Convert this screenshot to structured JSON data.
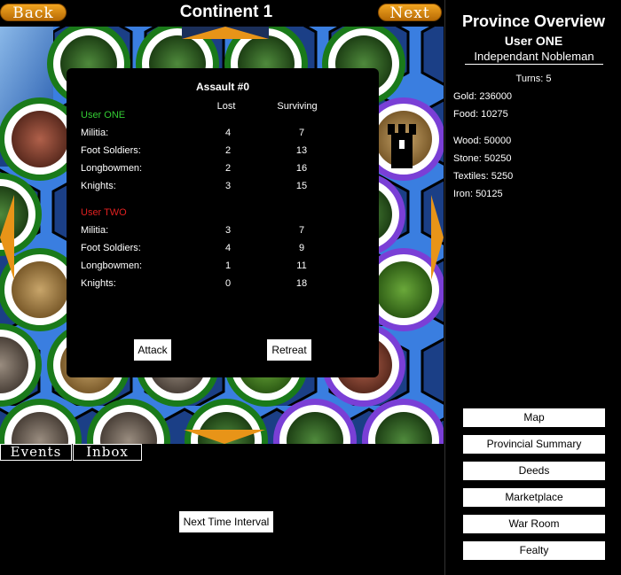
{
  "header": {
    "back_label": "Back",
    "next_label": "Next",
    "title": "Continent 1"
  },
  "dialog": {
    "title": "Assault #0",
    "col_lost": "Lost",
    "col_surviving": "Surviving",
    "sides": [
      {
        "name": "User ONE",
        "color": "#33cc33",
        "rows": [
          {
            "unit": "Militia:",
            "lost": "4",
            "surviving": "7"
          },
          {
            "unit": "Foot Soldiers:",
            "lost": "2",
            "surviving": "13"
          },
          {
            "unit": "Longbowmen:",
            "lost": "2",
            "surviving": "16"
          },
          {
            "unit": "Knights:",
            "lost": "3",
            "surviving": "15"
          }
        ]
      },
      {
        "name": "User TWO",
        "color": "#e02020",
        "rows": [
          {
            "unit": "Militia:",
            "lost": "3",
            "surviving": "7"
          },
          {
            "unit": "Foot Soldiers:",
            "lost": "4",
            "surviving": "9"
          },
          {
            "unit": "Longbowmen:",
            "lost": "1",
            "surviving": "11"
          },
          {
            "unit": "Knights:",
            "lost": "0",
            "surviving": "18"
          }
        ]
      }
    ],
    "attack_label": "Attack",
    "retreat_label": "Retreat"
  },
  "bottom": {
    "tab_events": "Events",
    "tab_inbox": "Inbox",
    "next_interval_label": "Next Time Interval"
  },
  "province": {
    "title": "Province Overview",
    "user": "User ONE",
    "rank": "Independant Nobleman",
    "turns": "Turns: 5",
    "gold": "Gold: 236000",
    "food": "Food: 10275",
    "wood": "Wood: 50000",
    "stone": "Stone: 50250",
    "textiles": "Textiles: 5250",
    "iron": "Iron: 50125"
  },
  "menu": [
    "Map",
    "Provincial Summary",
    "Deeds",
    "Marketplace",
    "War Room",
    "Fealty"
  ],
  "colors": {
    "accent_orange": "#e89418",
    "ring_green": "#1a7a1a",
    "ring_purple": "#7a3fd6",
    "hex_blue": "#3a7ee0"
  }
}
